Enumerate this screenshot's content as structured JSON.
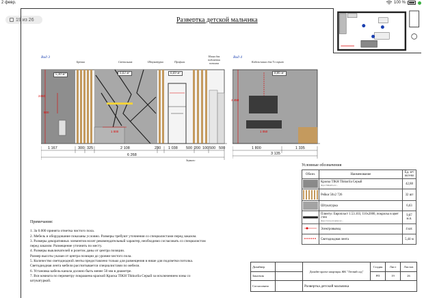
{
  "status_bar": {
    "time": "2 февр.",
    "battery": "100 %"
  },
  "viewer": {
    "page_counter": "19 из 26"
  },
  "sheet": {
    "title": "Развертка детской мальчика"
  },
  "views": {
    "view3": {
      "label": "Вид 3",
      "callouts": {
        "brick": "Бревна",
        "lamp": "Светильник",
        "shtukaturka": "Штукатурка",
        "profile": "Профиль",
        "niche": "Ниша для подсветки потолка"
      },
      "areas": [
        "5,30 м²",
        "6,63 м²",
        "6,69 м²"
      ],
      "dims": {
        "bottom_segments": [
          "1 167",
          "300",
          "325",
          "2 108",
          "230",
          "1 038",
          "500",
          "200",
          "100",
          "500",
          "500"
        ],
        "total": "6 268",
        "note_below": "Зеркало"
      },
      "red_marks": [
        "2450",
        "1 000",
        "900"
      ]
    },
    "view4": {
      "label": "Вид 4",
      "callout": "Кабель-канал для Tv скрыт",
      "area": "8,86 м²",
      "dims": {
        "segments": [
          "1 800",
          "1 335"
        ],
        "total": "3 135"
      },
      "red_marks": [
        "2 450",
        "1 050"
      ]
    }
  },
  "legend": {
    "title": "Условные обозначения",
    "headers": [
      "Обозн.",
      "Наименование",
      "Ед. м²/ кол-во"
    ],
    "rows": [
      {
        "symbol": "paint",
        "name": "Краска TIKH Tikkurila Серый",
        "sub": "https://tikkurila.ru/...",
        "value": "42,88"
      },
      {
        "symbol": "slats",
        "name": "Рейки 50х2 726",
        "sub": "",
        "value": "32 шт"
      },
      {
        "symbol": "plaster",
        "name": "Штукатурка",
        "sub": "",
        "value": "6,63"
      },
      {
        "symbol": "baseboard",
        "name": "Плинтус Европласт 1.53.103, 110х2000, покраска в цвет стен",
        "sub": "https://www.evroplast.ru/...",
        "value": "9,87 м.п."
      },
      {
        "symbol": "outlet",
        "name": "Электровывод",
        "sub": "",
        "value": "4 шт."
      },
      {
        "symbol": "ledstrip",
        "name": "Светодиодная лента",
        "sub": "",
        "value": "5,44 м"
      }
    ]
  },
  "notes": {
    "title": "Примечания:",
    "items": [
      "1. За 0.000 принята отметка чистого пола.",
      "2. Мебель и оборудование показаны условно. Размеры требуют уточнения со специалистами перед заказом.",
      "3. Размеры декоративных элементов носят рекомендательный характер, необходимо согласовать со специалистом",
      "перед заказом. Размещение уточнить по месту.",
      "4. Размеры выключателей и розеток даны от центра позиции.",
      "Размер высоты указан от центра позиции до уровня чистого пола.",
      "5. Количество светодиодной ленты предоставлено только для размещения в нише для подсветки потолка.",
      "Светодиодная лента мебели рассчитывается специалистами по мебели.",
      "6. Установка кабель-канала должно быть менее 50 мм в диаметре.",
      "7. Вся комната по периметру покрашена краской Краска TIKH Tikkurila Серый за исключением зоны со",
      "штукатуркой."
    ]
  },
  "titleblock": {
    "designer_label": "Дизайнер",
    "checked_label": "Заказчик",
    "approved_label": "Согласовано",
    "project": "Дизайн-проект квартиры ЖК \"Летний сад\"",
    "stage_label": "Стадия",
    "sheet_label": "Лист",
    "sheets_label": "Листов",
    "stage": "РП",
    "sheet_no": "19",
    "sheets_total": "26",
    "drawing_name": "Развертка детской мальчика"
  },
  "colors": {
    "wall_gray": "#8a8a8a",
    "plaster": "#a3a3a3",
    "wood": "#c49a5e",
    "tv_dark": "#3a3a3a",
    "dim_red": "#dd0000",
    "accent_blue": "#1a3fb0",
    "led_yellow": "#f2d23c"
  }
}
